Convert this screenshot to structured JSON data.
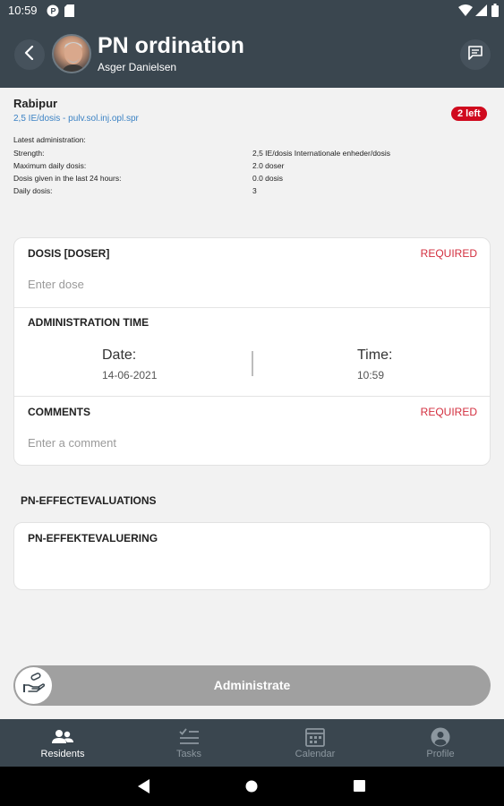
{
  "status_bar": {
    "time": "10:59"
  },
  "header": {
    "title": "PN ordination",
    "subtitle": "Asger Danielsen"
  },
  "medication": {
    "name": "Rabipur",
    "dose_link": "2,5 IE/dosis - pulv.sol.inj.opl.spr",
    "remaining_badge": "2 left",
    "details": [
      {
        "label": "Latest administration:",
        "value": ""
      },
      {
        "label": "Strength:",
        "value": "2,5 IE/dosis Internationale enheder/dosis"
      },
      {
        "label": "Maximum daily dosis:",
        "value": "2.0 doser"
      },
      {
        "label": "Dosis given in the last 24 hours:",
        "value": "0.0 dosis"
      },
      {
        "label": "Daily dosis:",
        "value": "3"
      }
    ]
  },
  "form": {
    "dose": {
      "title": "DOSIS [DOSER]",
      "required": "REQUIRED",
      "placeholder": "Enter dose"
    },
    "administration_time": {
      "title": "ADMINISTRATION TIME",
      "date_label": "Date:",
      "date_value": "14-06-2021",
      "time_label": "Time:",
      "time_value": "10:59"
    },
    "comments": {
      "title": "COMMENTS",
      "required": "REQUIRED",
      "placeholder": "Enter a comment"
    }
  },
  "evaluations": {
    "heading": "PN-EFFECTEVALUATIONS",
    "card_title": "PN-EFFEKTEVALUERING"
  },
  "action": {
    "label": "Administrate"
  },
  "bottom_nav": {
    "items": [
      {
        "label": "Residents",
        "icon": "people-icon",
        "active": true
      },
      {
        "label": "Tasks",
        "icon": "tasks-icon",
        "active": false
      },
      {
        "label": "Calendar",
        "icon": "calendar-icon",
        "active": false
      },
      {
        "label": "Profile",
        "icon": "profile-icon",
        "active": false
      }
    ]
  },
  "colors": {
    "appbar": "#3a464f",
    "badge": "#d00a1e",
    "required": "#d32f3f",
    "link": "#3b82c4",
    "slider": "#a0a0a0"
  }
}
